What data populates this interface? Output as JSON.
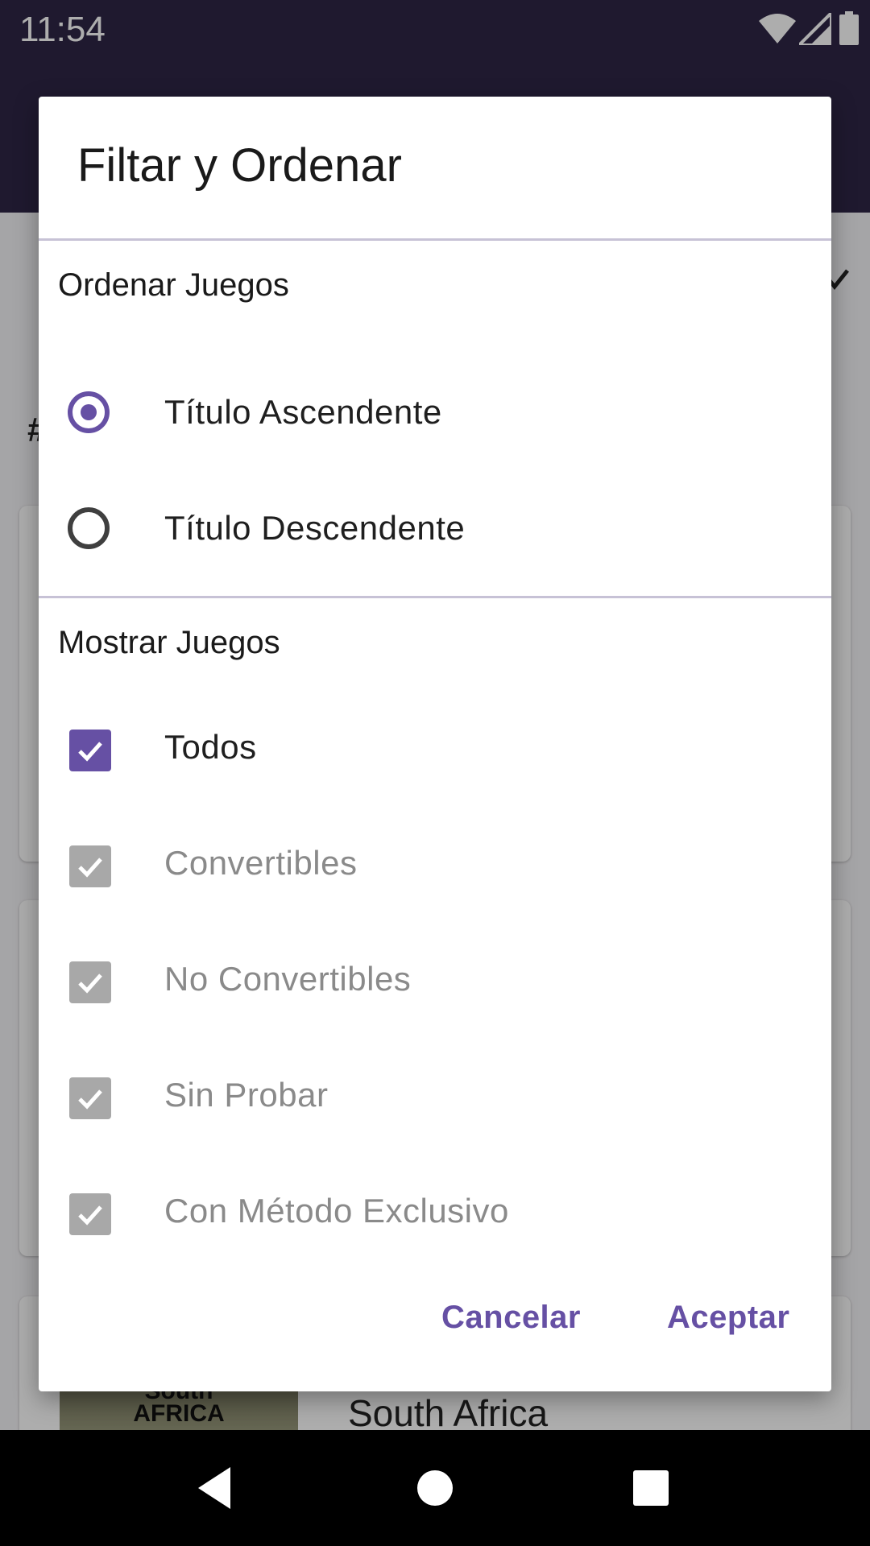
{
  "status_bar": {
    "time": "11:54",
    "icons": [
      "wifi-icon",
      "cell-signal-icon",
      "battery-icon"
    ]
  },
  "background": {
    "sort_label": "",
    "count_label": "#",
    "cards": [
      {
        "title": ""
      },
      {
        "title": ""
      },
      {
        "title": "South Africa",
        "thumb_text": "South\nAFRICA"
      }
    ]
  },
  "dialog": {
    "title": "Filtar y Ordenar",
    "sort_section": {
      "label": "Ordenar Juegos",
      "options": [
        {
          "label": "Título Ascendente",
          "selected": true
        },
        {
          "label": "Título Descendente",
          "selected": false
        }
      ]
    },
    "show_section": {
      "label": "Mostrar Juegos",
      "options": [
        {
          "label": "Todos",
          "checked": true,
          "enabled": true
        },
        {
          "label": "Convertibles",
          "checked": true,
          "enabled": false
        },
        {
          "label": "No Convertibles",
          "checked": true,
          "enabled": false
        },
        {
          "label": "Sin Probar",
          "checked": true,
          "enabled": false
        },
        {
          "label": "Con Método Exclusivo",
          "checked": true,
          "enabled": false
        }
      ]
    },
    "buttons": {
      "cancel": "Cancelar",
      "accept": "Aceptar"
    }
  },
  "colors": {
    "accent": "#6650a4",
    "app_bar": "#2e2646",
    "disabled": "#a8a8a8"
  },
  "nav_bar": {
    "icons": [
      "back-icon",
      "home-icon",
      "recents-icon"
    ]
  }
}
